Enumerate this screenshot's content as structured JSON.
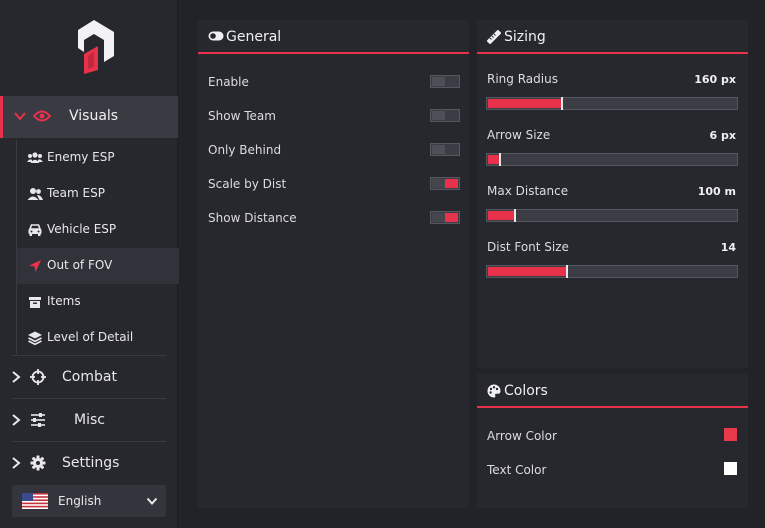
{
  "sidebar": {
    "visuals_label": "Visuals",
    "sub_items": [
      {
        "label": "Enemy ESP",
        "icon": "users-icon"
      },
      {
        "label": "Team ESP",
        "icon": "user-group-icon"
      },
      {
        "label": "Vehicle ESP",
        "icon": "car-icon"
      },
      {
        "label": "Out of FOV",
        "icon": "location-arrow-icon"
      },
      {
        "label": "Items",
        "icon": "box-icon"
      },
      {
        "label": "Level of Detail",
        "icon": "layers-icon"
      }
    ],
    "nav": [
      {
        "label": "Combat",
        "icon": "crosshair-icon"
      },
      {
        "label": "Misc",
        "icon": "sliders-icon"
      },
      {
        "label": "Settings",
        "icon": "gear-icon"
      }
    ],
    "language": "English"
  },
  "general": {
    "title": "General",
    "rows": [
      {
        "label": "Enable",
        "on": false
      },
      {
        "label": "Show Team",
        "on": false
      },
      {
        "label": "Only Behind",
        "on": false
      },
      {
        "label": "Scale by Dist",
        "on": true
      },
      {
        "label": "Show Distance",
        "on": true
      }
    ]
  },
  "sizing": {
    "title": "Sizing",
    "rows": [
      {
        "label": "Ring Radius",
        "value": "160 px",
        "fraction": 0.29
      },
      {
        "label": "Arrow Size",
        "value": "6 px",
        "fraction": 0.04
      },
      {
        "label": "Max Distance",
        "value": "100 m",
        "fraction": 0.1
      },
      {
        "label": "Dist Font Size",
        "value": "14",
        "fraction": 0.31
      }
    ]
  },
  "colors": {
    "title": "Colors",
    "rows": [
      {
        "label": "Arrow Color",
        "color": "#e8394d"
      },
      {
        "label": "Text Color",
        "color": "#ffffff"
      }
    ]
  },
  "theme": {
    "accent": "#e8314a"
  }
}
